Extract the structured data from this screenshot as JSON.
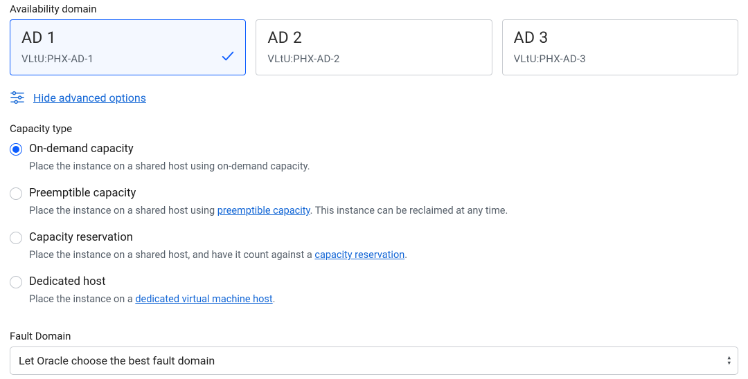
{
  "availability_domain": {
    "label": "Availability domain",
    "options": [
      {
        "title": "AD 1",
        "subtitle": "VLtU:PHX-AD-1",
        "selected": true
      },
      {
        "title": "AD 2",
        "subtitle": "VLtU:PHX-AD-2",
        "selected": false
      },
      {
        "title": "AD 3",
        "subtitle": "VLtU:PHX-AD-3",
        "selected": false
      }
    ]
  },
  "advanced_toggle": {
    "label": "Hide advanced options"
  },
  "capacity_type": {
    "label": "Capacity type",
    "options": [
      {
        "title": "On-demand capacity",
        "desc_pre": "Place the instance on a shared host using on-demand capacity.",
        "link": "",
        "desc_post": "",
        "selected": true
      },
      {
        "title": "Preemptible capacity",
        "desc_pre": "Place the instance on a shared host using ",
        "link": "preemptible capacity",
        "desc_post": ". This instance can be reclaimed at any time.",
        "selected": false
      },
      {
        "title": "Capacity reservation",
        "desc_pre": "Place the instance on a shared host, and have it count against a ",
        "link": "capacity reservation",
        "desc_post": ".",
        "selected": false
      },
      {
        "title": "Dedicated host",
        "desc_pre": "Place the instance on a ",
        "link": "dedicated virtual machine host",
        "desc_post": ".",
        "selected": false
      }
    ]
  },
  "fault_domain": {
    "label": "Fault Domain",
    "selected": "Let Oracle choose the best fault domain"
  }
}
